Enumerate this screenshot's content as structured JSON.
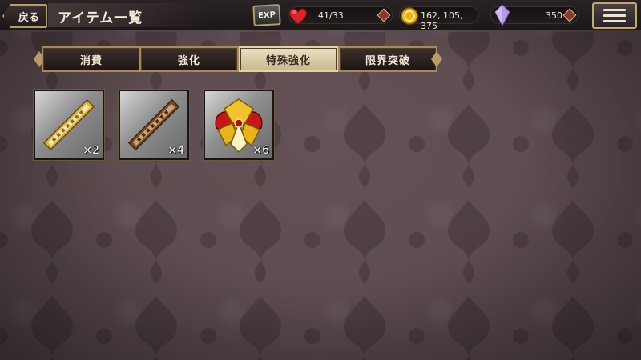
{
  "header": {
    "back_label": "戻る",
    "title": "アイテム一覧",
    "exp_label": "EXP",
    "stamina": "41/33",
    "gold": "162, 105, 375",
    "gems": "350"
  },
  "tabs": [
    {
      "label": "消費",
      "active": false
    },
    {
      "label": "強化",
      "active": false
    },
    {
      "label": "特殊強化",
      "active": true
    },
    {
      "label": "限界突破",
      "active": false
    }
  ],
  "items": [
    {
      "icon": "gold-stick-icon",
      "quantity": "×2"
    },
    {
      "icon": "bronze-stick-icon",
      "quantity": "×4"
    },
    {
      "icon": "golden-emblem-icon",
      "quantity": "×6"
    }
  ],
  "colors": {
    "accent_gold": "#b89b6a",
    "active_tab": "#e9e0c4",
    "background": "#5a4a4e"
  }
}
